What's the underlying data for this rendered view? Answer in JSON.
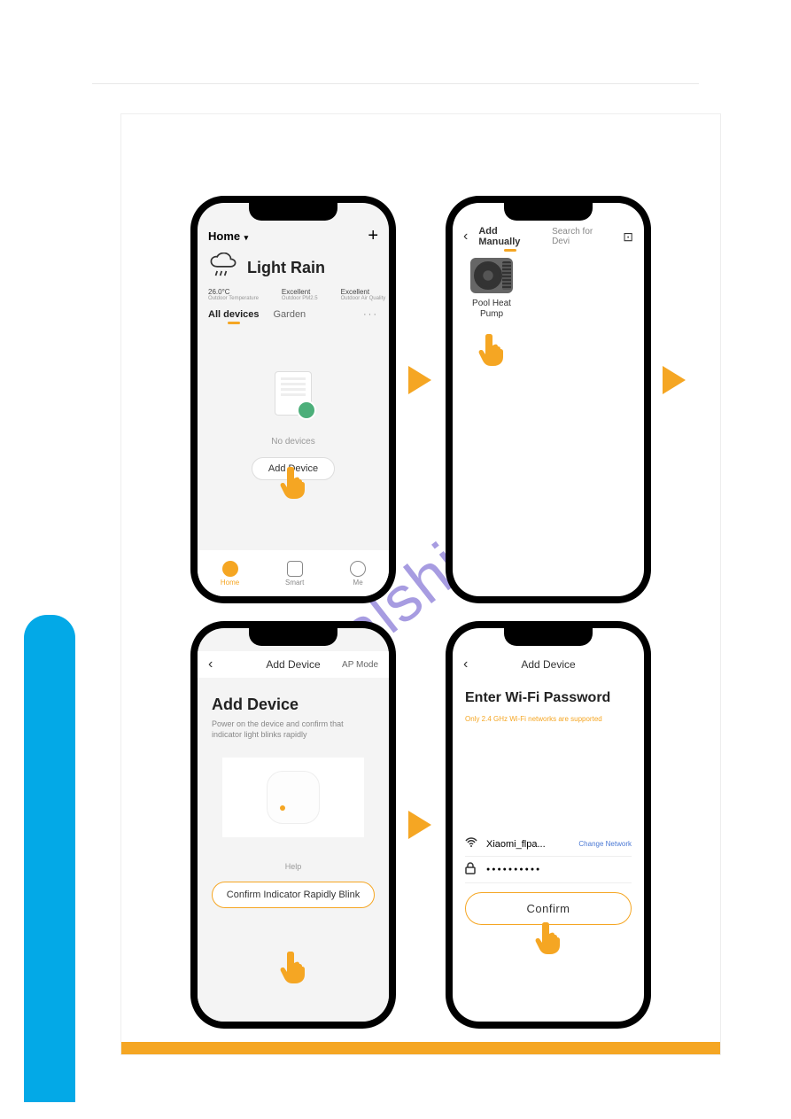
{
  "watermark": "manualshive.com",
  "phone1": {
    "home_label": "Home",
    "plus": "+",
    "weather": "Light Rain",
    "temp": "26.0°C",
    "temp_sub": "Outdoor Temperature",
    "pm_label": "Excellent",
    "pm_sub": "Outdoor PM2.5",
    "aq_label": "Excellent",
    "aq_sub": "Outdoor Air Quality",
    "tab_all": "All devices",
    "tab_garden": "Garden",
    "more": "···",
    "no_devices": "No devices",
    "add_device": "Add Device",
    "nav_home": "Home",
    "nav_smart": "Smart",
    "nav_me": "Me"
  },
  "phone2": {
    "back": "‹",
    "add_manually": "Add Manually",
    "search_for_device": "Search for Devi",
    "scan": "⊡",
    "device_name": "Pool Heat Pump"
  },
  "phone3": {
    "back": "‹",
    "title": "Add Device",
    "ap_mode": "AP Mode",
    "card_title": "Add Device",
    "card_desc": "Power on the device and confirm that indicator light blinks rapidly",
    "help": "Help",
    "confirm_blink": "Confirm Indicator Rapidly Blink"
  },
  "phone4": {
    "back": "‹",
    "title": "Add Device",
    "wifi_title": "Enter Wi-Fi Password",
    "wifi_note": "Only 2.4 GHz Wi-Fi networks are supported",
    "ssid": "Xiaomi_flpa...",
    "change_network": "Change Network",
    "password_dots": "●●●●●●●●●●",
    "confirm": "Confirm"
  }
}
